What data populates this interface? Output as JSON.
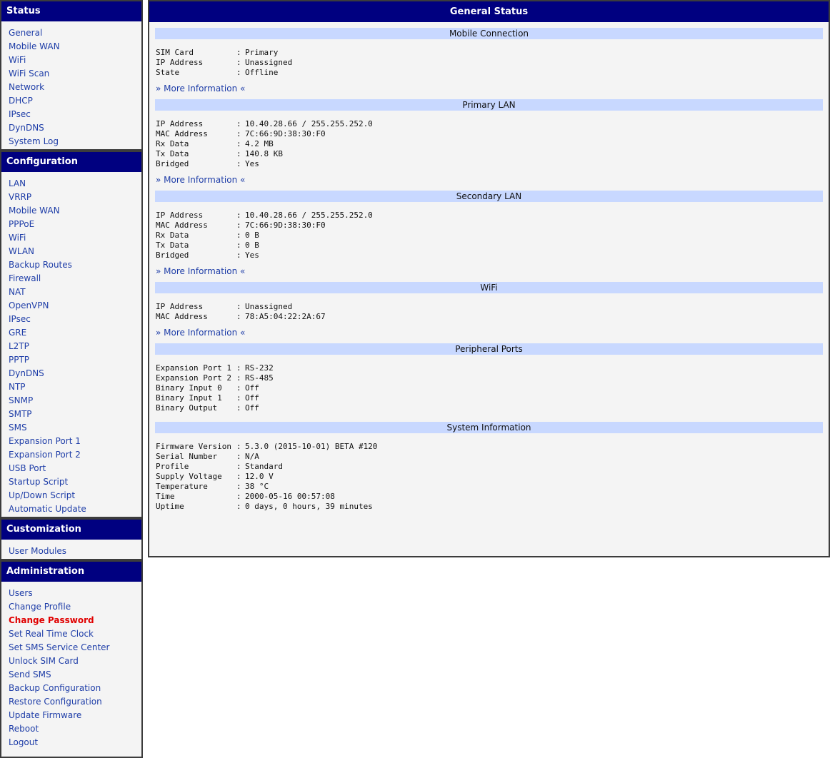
{
  "sidebar": {
    "sections": [
      {
        "title": "Status",
        "items": [
          "General",
          "Mobile WAN",
          "WiFi",
          "WiFi Scan",
          "Network",
          "DHCP",
          "IPsec",
          "DynDNS",
          "System Log"
        ]
      },
      {
        "title": "Configuration",
        "items": [
          "LAN",
          "VRRP",
          "Mobile WAN",
          "PPPoE",
          "WiFi",
          "WLAN",
          "Backup Routes",
          "Firewall",
          "NAT",
          "OpenVPN",
          "IPsec",
          "GRE",
          "L2TP",
          "PPTP",
          "DynDNS",
          "NTP",
          "SNMP",
          "SMTP",
          "SMS",
          "Expansion Port 1",
          "Expansion Port 2",
          "USB Port",
          "Startup Script",
          "Up/Down Script",
          "Automatic Update"
        ]
      },
      {
        "title": "Customization",
        "items": [
          "User Modules"
        ]
      },
      {
        "title": "Administration",
        "items": [
          "Users",
          "Change Profile",
          "Change Password",
          "Set Real Time Clock",
          "Set SMS Service Center",
          "Unlock SIM Card",
          "Send SMS",
          "Backup Configuration",
          "Restore Configuration",
          "Update Firmware",
          "Reboot",
          "Logout"
        ],
        "active_item": "Change Password"
      }
    ]
  },
  "main": {
    "title": "General Status",
    "more_info_label": "» More Information «",
    "sections": [
      {
        "title": "Mobile Connection",
        "rows": [
          [
            "SIM Card",
            "Primary"
          ],
          [
            "IP Address",
            "Unassigned"
          ],
          [
            "State",
            "Offline"
          ]
        ],
        "more": true
      },
      {
        "title": "Primary LAN",
        "rows": [
          [
            "IP Address",
            "10.40.28.66 / 255.255.252.0"
          ],
          [
            "MAC Address",
            "7C:66:9D:38:30:F0"
          ],
          [
            "Rx Data",
            "4.2 MB"
          ],
          [
            "Tx Data",
            "140.8 KB"
          ],
          [
            "Bridged",
            "Yes"
          ]
        ],
        "more": true
      },
      {
        "title": "Secondary LAN",
        "rows": [
          [
            "IP Address",
            "10.40.28.66 / 255.255.252.0"
          ],
          [
            "MAC Address",
            "7C:66:9D:38:30:F0"
          ],
          [
            "Rx Data",
            "0 B"
          ],
          [
            "Tx Data",
            "0 B"
          ],
          [
            "Bridged",
            "Yes"
          ]
        ],
        "more": true
      },
      {
        "title": "WiFi",
        "rows": [
          [
            "IP Address",
            "Unassigned"
          ],
          [
            "MAC Address",
            "78:A5:04:22:2A:67"
          ]
        ],
        "more": true
      },
      {
        "title": "Peripheral Ports",
        "rows": [
          [
            "Expansion Port 1",
            "RS-232"
          ],
          [
            "Expansion Port 2",
            "RS-485"
          ],
          [
            "Binary Input 0",
            "Off"
          ],
          [
            "Binary Input 1",
            "Off"
          ],
          [
            "Binary Output",
            "Off"
          ]
        ],
        "more": false
      },
      {
        "title": "System Information",
        "rows": [
          [
            "Firmware Version",
            "5.3.0 (2015-10-01) BETA #120"
          ],
          [
            "Serial Number",
            "N/A"
          ],
          [
            "Profile",
            "Standard"
          ],
          [
            "Supply Voltage",
            "12.0 V"
          ],
          [
            "Temperature",
            "38 °C"
          ],
          [
            "Time",
            "2000-05-16 00:57:08"
          ],
          [
            "Uptime",
            "0 days, 0 hours, 39 minutes"
          ]
        ],
        "more": false
      }
    ]
  },
  "colors": {
    "header_bg": "#000080",
    "section_header_bg": "#c8d8ff",
    "link": "#1f3ea8",
    "active_link": "#e00000",
    "panel_bg": "#f4f4f4"
  }
}
